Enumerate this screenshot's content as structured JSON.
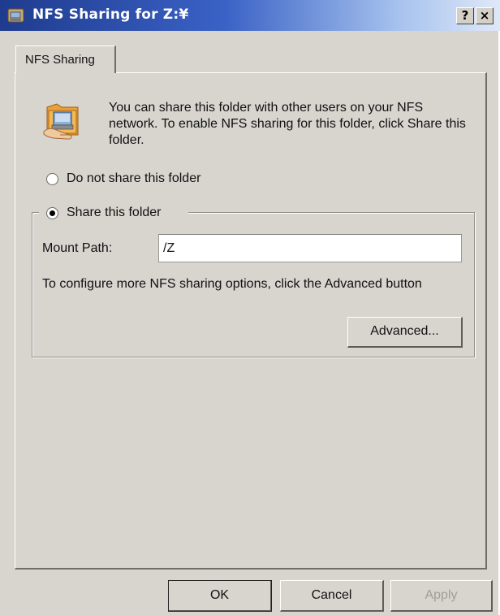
{
  "window": {
    "title": "NFS Sharing for Z:¥",
    "help_label": "?",
    "close_label": "×"
  },
  "tabs": [
    {
      "label": "NFS Sharing",
      "active": true
    }
  ],
  "panel": {
    "icon": "shared-folder-icon",
    "description": "You can share this folder with other users on your NFS network. To enable NFS sharing for this folder, click Share this folder.",
    "options": {
      "do_not_share": {
        "label": "Do not share this folder",
        "selected": false
      },
      "share": {
        "label": "Share this folder",
        "selected": true
      }
    },
    "mount_path": {
      "label": "Mount Path:",
      "value": "/Z"
    },
    "configure_text": "To configure more NFS sharing options, click the Advanced button",
    "advanced_label": "Advanced..."
  },
  "footer": {
    "ok_label": "OK",
    "cancel_label": "Cancel",
    "apply_label": "Apply",
    "apply_enabled": false
  },
  "colors": {
    "titlebar_start": "#1f3b8e",
    "titlebar_end": "#dfe8f8",
    "dialog_bg": "#d8d5cf",
    "disabled_text": "#a19e99"
  }
}
